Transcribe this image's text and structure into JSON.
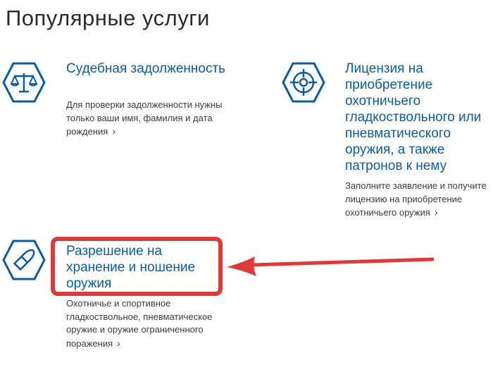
{
  "page": {
    "title": "Популярные услуги"
  },
  "services": [
    {
      "icon": "scales-icon",
      "title": "Судебная задолженность",
      "description": "Для проверки задолженности нужны только ваши имя, фамилия и дата рождения"
    },
    {
      "icon": "crosshair-icon",
      "title": "Лицензия на приобретение охотничьего гладкоствольного или пневматического оружия, а также патронов к нему",
      "description": "Заполните заявление и получите лицензию на приобретение охотничьего оружия"
    },
    {
      "icon": "bullet-icon",
      "title": "Разрешение на хранение и ношение оружия",
      "description": "Охотничье и спортивное гладкоствольное, пневматическое оружие и оружие ограниченного поражения"
    }
  ],
  "colors": {
    "icon_border": "#0b5c9f",
    "link": "#0b5c9f",
    "annotation": "#dd3a3a"
  }
}
